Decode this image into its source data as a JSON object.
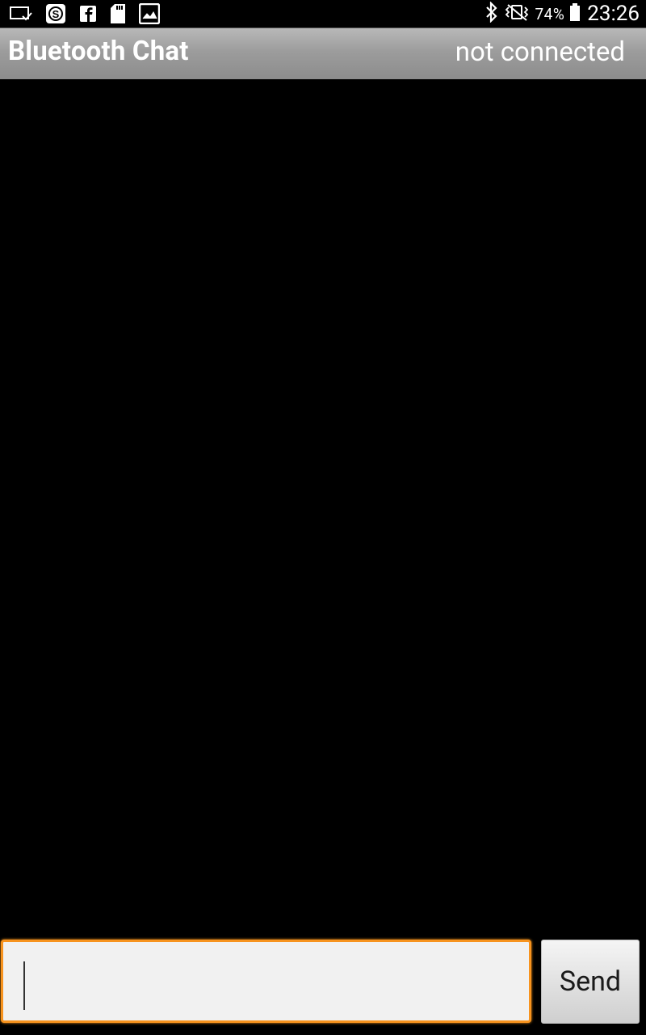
{
  "status_bar": {
    "left_icons": [
      "cast-icon",
      "shazam-icon",
      "facebook-icon",
      "sd-card-icon",
      "gallery-icon"
    ],
    "right_icons": [
      "bluetooth-icon",
      "vibrate-icon"
    ],
    "battery_percent": "74%",
    "time": "23:26"
  },
  "title_bar": {
    "title": "Bluetooth Chat",
    "connection_status": "not connected"
  },
  "input": {
    "value": "",
    "placeholder": ""
  },
  "send_button": {
    "label": "Send"
  },
  "colors": {
    "title_bar": "#9c9c9c",
    "input_focus_border": "#f7931e",
    "background": "#000000"
  }
}
